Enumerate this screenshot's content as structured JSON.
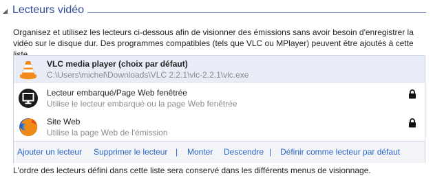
{
  "section": {
    "title": "Lecteurs vidéo"
  },
  "description": "Organisez et utilisez les lecteurs ci-dessous afin de visionner des émissions sans avoir besoin d'enregistrer la vidéo sur le disque dur. Des programmes compatibles (tels que VLC ou MPlayer) peuvent être ajoutés à cette liste.",
  "players": [
    {
      "name": "VLC media player (choix par défaut)",
      "detail": "C:\\Users\\michel\\Downloads\\VLC 2.2.1\\vlc-2.2.1\\vlc.exe",
      "icon": "vlc-cone-icon",
      "selected": true,
      "locked": false
    },
    {
      "name": "Lecteur embarqué/Page Web fenêtrée",
      "detail": "Utilise le lecteur embarqué ou la page Web fenêtrée",
      "icon": "monitor-icon",
      "selected": false,
      "locked": true
    },
    {
      "name": "Site Web",
      "detail": "Utilise la page Web de l'émission",
      "icon": "firefox-icon",
      "selected": false,
      "locked": true
    }
  ],
  "actions": {
    "add": "Ajouter un lecteur",
    "remove": "Supprimer le lecteur",
    "separator": "|",
    "up": "Monter",
    "down": "Descendre",
    "set_default": "Définir comme lecteur par défaut"
  },
  "footer": "L'ordre des lecteurs défini dans cette liste sera conservé dans les différents menus de visionnage.",
  "colors": {
    "title": "#2f4d9b",
    "link": "#2b66c4",
    "selected_row": "#e8ecf6"
  }
}
